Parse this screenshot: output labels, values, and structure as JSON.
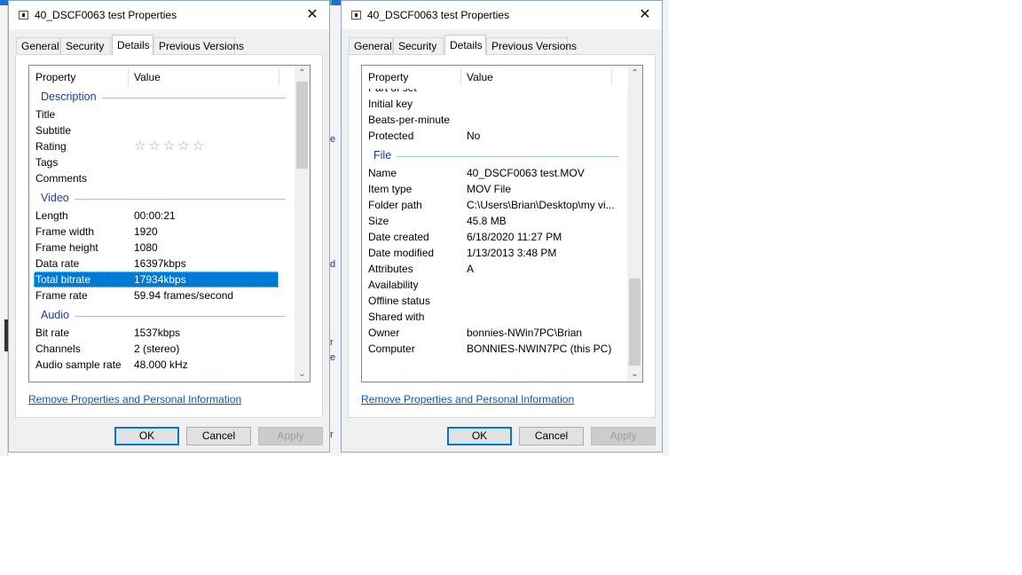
{
  "dialogs": [
    {
      "title": "40_DSCF0063  test Properties",
      "tabs": [
        "General",
        "Security",
        "Details",
        "Previous Versions"
      ],
      "active_tab": "Details",
      "columns": [
        "Property",
        "Value"
      ],
      "link": "Remove Properties and Personal Information",
      "buttons": {
        "ok": "OK",
        "cancel": "Cancel",
        "apply": "Apply"
      },
      "groups": {
        "description": "Description",
        "video": "Video",
        "audio": "Audio"
      },
      "rows": {
        "title": [
          "Title",
          ""
        ],
        "subtitle": [
          "Subtitle",
          ""
        ],
        "rating": [
          "Rating",
          "☆☆☆☆☆"
        ],
        "tags": [
          "Tags",
          ""
        ],
        "comments": [
          "Comments",
          ""
        ],
        "length": [
          "Length",
          "00:00:21"
        ],
        "frame_width": [
          "Frame width",
          "1920"
        ],
        "frame_height": [
          "Frame height",
          "1080"
        ],
        "data_rate": [
          "Data rate",
          "16397kbps"
        ],
        "total_bitrate": [
          "Total bitrate",
          "17934kbps"
        ],
        "frame_rate": [
          "Frame rate",
          "59.94 frames/second"
        ],
        "bit_rate": [
          "Bit rate",
          "1537kbps"
        ],
        "channels": [
          "Channels",
          "2 (stereo)"
        ],
        "audio_sample_rate": [
          "Audio sample rate",
          "48.000 kHz"
        ]
      },
      "selected_row": "Total bitrate",
      "rating_stars_filled": 0
    },
    {
      "title": "40_DSCF0063  test Properties",
      "tabs": [
        "General",
        "Security",
        "Details",
        "Previous Versions"
      ],
      "active_tab": "Details",
      "columns": [
        "Property",
        "Value"
      ],
      "link": "Remove Properties and Personal Information",
      "buttons": {
        "ok": "OK",
        "cancel": "Cancel",
        "apply": "Apply"
      },
      "groups": {
        "file": "File"
      },
      "rows": {
        "part_of_set": [
          "Part of set",
          ""
        ],
        "initial_key": [
          "Initial key",
          ""
        ],
        "beats_per_minute": [
          "Beats-per-minute",
          ""
        ],
        "protected": [
          "Protected",
          "No"
        ],
        "name": [
          "Name",
          "40_DSCF0063  test.MOV"
        ],
        "item_type": [
          "Item type",
          "MOV File"
        ],
        "folder_path": [
          "Folder path",
          "C:\\Users\\Brian\\Desktop\\my vi..."
        ],
        "size": [
          "Size",
          "45.8 MB"
        ],
        "date_created": [
          "Date created",
          "6/18/2020 11:27 PM"
        ],
        "date_modified": [
          "Date modified",
          "1/13/2013 3:48 PM"
        ],
        "attributes": [
          "Attributes",
          "A"
        ],
        "availability": [
          "Availability",
          ""
        ],
        "offline_status": [
          "Offline status",
          ""
        ],
        "shared_with": [
          "Shared with",
          ""
        ],
        "owner": [
          "Owner",
          "bonnies-NWin7PC\\Brian"
        ],
        "computer": [
          "Computer",
          "BONNIES-NWIN7PC (this PC)"
        ]
      }
    }
  ],
  "background_glyphs": [
    "e",
    "d",
    "r",
    "e",
    "r"
  ],
  "colors": {
    "selection": "#0078d7",
    "group_heading": "#1e3c96",
    "link": "#0f56b3",
    "default_button_border": "#0078d7"
  }
}
